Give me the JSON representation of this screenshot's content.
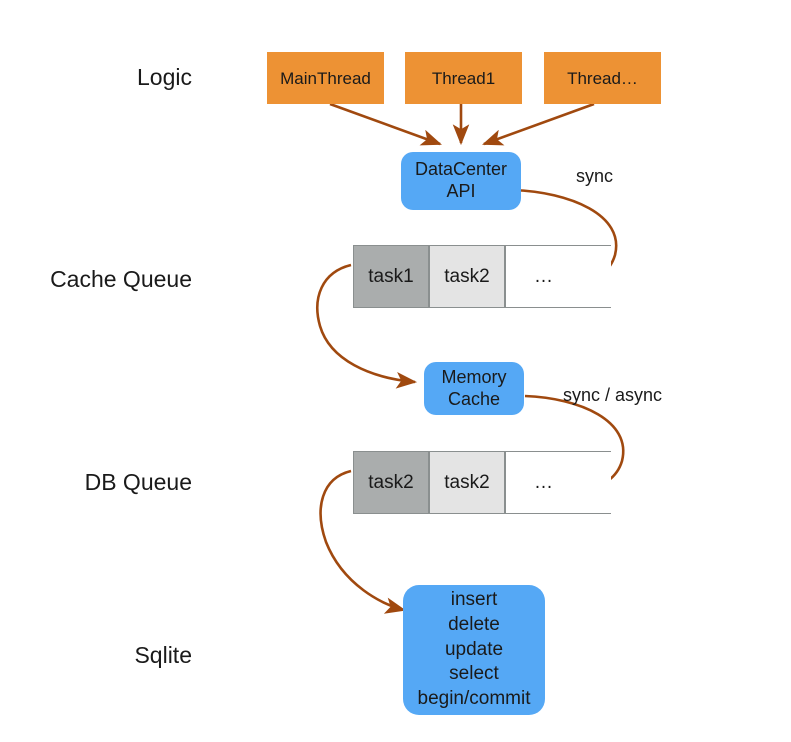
{
  "diagram": {
    "rows": [
      {
        "label": "Logic"
      },
      {
        "label": "Cache Queue"
      },
      {
        "label": "DB Queue"
      },
      {
        "label": "Sqlite"
      }
    ],
    "threads": [
      {
        "label": "MainThread"
      },
      {
        "label": "Thread1"
      },
      {
        "label": "Thread…"
      }
    ],
    "datacenter_node": {
      "line1": "DataCenter",
      "line2": "API"
    },
    "memory_cache_node": {
      "line1": "Memory",
      "line2": "Cache"
    },
    "sqlite_node": {
      "operations": [
        "insert",
        "delete",
        "update",
        "select",
        "begin/commit"
      ]
    },
    "cache_queue": {
      "cells": [
        {
          "label": "task1",
          "style": "filled-dark"
        },
        {
          "label": "task2",
          "style": "filled-light"
        },
        {
          "label": "…",
          "style": "open-end"
        }
      ]
    },
    "db_queue": {
      "cells": [
        {
          "label": "task2",
          "style": "filled-dark"
        },
        {
          "label": "task2",
          "style": "filled-light"
        },
        {
          "label": "…",
          "style": "open-end"
        }
      ]
    },
    "edge_labels": [
      {
        "label": "sync"
      },
      {
        "label": "sync / async"
      }
    ],
    "colors": {
      "thread_orange": "#ed9234",
      "node_blue": "#55a8f5",
      "arrow_brown": "#a0490f",
      "queue_dark": "#aaadad",
      "queue_light": "#e4e4e4",
      "queue_border": "#8a8f8f",
      "text": "#1a1a1a",
      "background": "#ffffff"
    }
  }
}
